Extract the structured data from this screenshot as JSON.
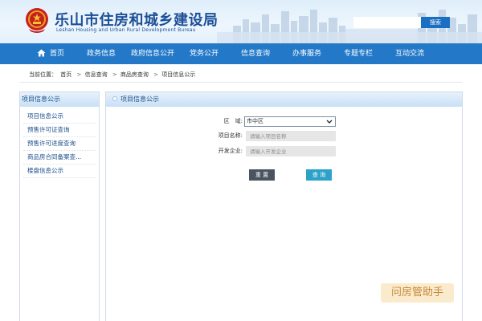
{
  "header": {
    "site_title": "乐山市住房和城乡建设局",
    "site_subtitle": "Leshan Housing and Urban Rural Development Bureau",
    "search": {
      "placeholder": "",
      "button_label": "搜索"
    }
  },
  "nav": {
    "items": [
      {
        "label": "首页",
        "icon": "home-icon"
      },
      {
        "label": "政务信息"
      },
      {
        "label": "政府信息公开"
      },
      {
        "label": "党务公开"
      },
      {
        "label": "信息查询"
      },
      {
        "label": "办事服务"
      },
      {
        "label": "专题专栏"
      },
      {
        "label": "互动交流"
      }
    ]
  },
  "breadcrumb": {
    "prefix": "当前位置：",
    "items": [
      "首页",
      "信息查询",
      "商品房查询",
      "项目信息公示"
    ],
    "separator": ">"
  },
  "sidebar": {
    "title": "项目信息公示",
    "items": [
      {
        "label": "项目信息公示"
      },
      {
        "label": "预售许可证查询"
      },
      {
        "label": "预售许可进度查询"
      },
      {
        "label": "商品房合同备案查..."
      },
      {
        "label": "楼盘信息公示"
      }
    ]
  },
  "main": {
    "title": "项目信息公示",
    "form": {
      "region_label": "区　域:",
      "region_value": "市中区",
      "project_label": "项目名称:",
      "project_placeholder": "请输入项目名称",
      "developer_label": "开发企业:",
      "developer_placeholder": "请输入开发企业",
      "reset_label": "重 置",
      "query_label": "查 询"
    }
  },
  "watermark": {
    "text": "问房管助手"
  },
  "colors": {
    "nav_bg": "#2379c8",
    "title_blue": "#1c4f97",
    "reset_btn": "#4a5460",
    "query_btn": "#2ca2c9",
    "watermark_bg": "#fbe9c8",
    "watermark_text": "#c07a21"
  }
}
